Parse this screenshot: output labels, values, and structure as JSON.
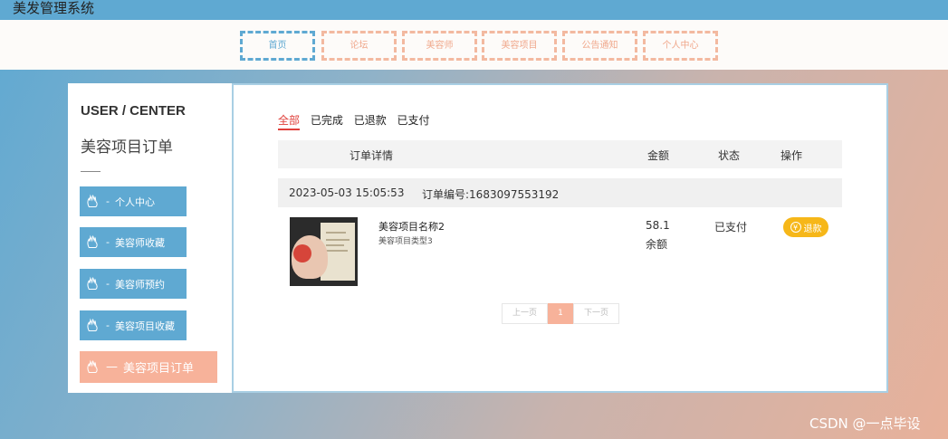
{
  "app": {
    "title": "美发管理系统"
  },
  "nav": {
    "items": [
      {
        "label": "首页",
        "active": true
      },
      {
        "label": "论坛"
      },
      {
        "label": "美容师"
      },
      {
        "label": "美容项目"
      },
      {
        "label": "公告通知"
      },
      {
        "label": "个人中心"
      }
    ]
  },
  "sidebar": {
    "heading": "USER / CENTER",
    "title": "美容项目订单",
    "items": [
      {
        "label": "个人中心"
      },
      {
        "label": "美容师收藏"
      },
      {
        "label": "美容师预约"
      },
      {
        "label": "美容项目收藏"
      },
      {
        "label": "美容项目订单",
        "active": true
      }
    ]
  },
  "orders": {
    "tabs": [
      {
        "label": "全部",
        "active": true
      },
      {
        "label": "已完成"
      },
      {
        "label": "已退款"
      },
      {
        "label": "已支付"
      }
    ],
    "columns": {
      "detail": "订单详情",
      "amount": "金额",
      "status": "状态",
      "action": "操作"
    },
    "list": [
      {
        "time": "2023-05-03 15:05:53",
        "number": "订单编号:1683097553192",
        "product_name": "美容项目名称2",
        "product_type": "美容项目类型3",
        "amount": "58.1",
        "pay_type": "余额",
        "status": "已支付",
        "action": "退款"
      }
    ]
  },
  "pagination": {
    "prev": "上一页",
    "current": "1",
    "next": "下一页"
  },
  "watermark": "CSDN @一点毕设",
  "colors": {
    "blue": "#5fa9d2",
    "peach": "#f7b29a",
    "tab_active": "#e0413c",
    "button": "#f6b719"
  }
}
